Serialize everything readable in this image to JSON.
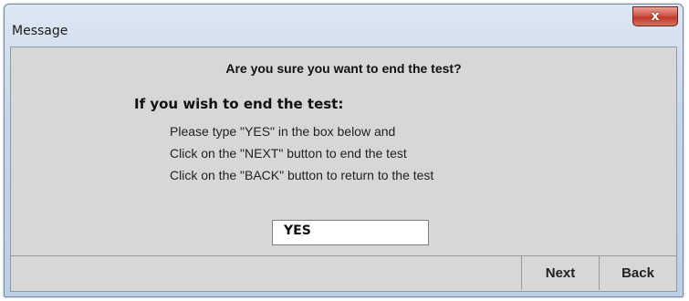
{
  "window": {
    "title": "Message",
    "close_label": "x"
  },
  "dialog": {
    "question": "Are you sure you want to end the test?",
    "heading": "If you wish to end the test:",
    "lines": [
      "Please type \"YES\" in the box below and",
      "Click on the \"NEXT\" button to end the test",
      "Click on the \"BACK\" button to return to the test"
    ],
    "input_value": "YES"
  },
  "buttons": {
    "next": "Next",
    "back": "Back"
  }
}
